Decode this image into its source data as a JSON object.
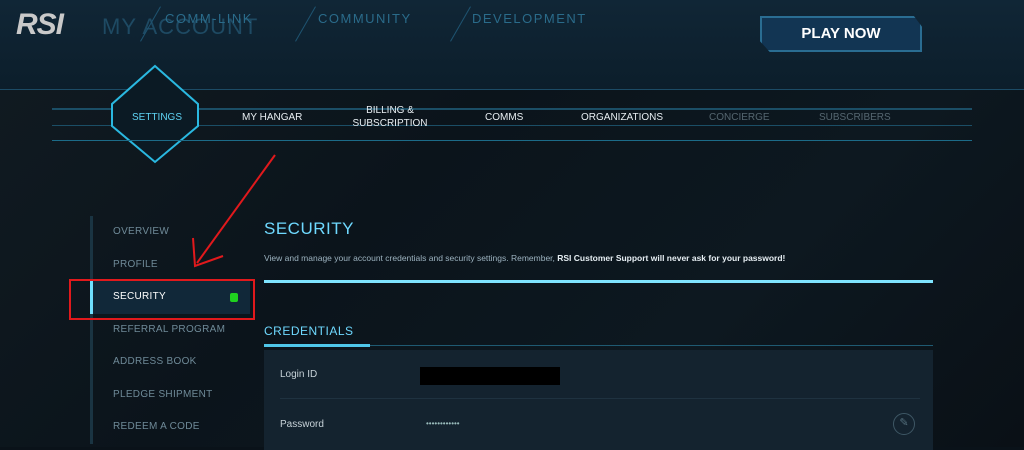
{
  "header": {
    "logo": "RSI",
    "page_title": "MY ACCOUNT",
    "nav": [
      "COMM-LINK",
      "COMMUNITY",
      "DEVELOPMENT"
    ],
    "play_now": "PLAY NOW"
  },
  "tabs": [
    {
      "label": "SETTINGS",
      "active": true
    },
    {
      "label": "MY HANGAR"
    },
    {
      "label": "BILLING & SUBSCRIPTION"
    },
    {
      "label": "COMMS"
    },
    {
      "label": "ORGANIZATIONS"
    },
    {
      "label": "CONCIERGE",
      "disabled": true
    },
    {
      "label": "SUBSCRIBERS",
      "disabled": true
    }
  ],
  "sidebar": {
    "items": [
      {
        "label": "OVERVIEW"
      },
      {
        "label": "PROFILE"
      },
      {
        "label": "SECURITY",
        "active": true
      },
      {
        "label": "REFERRAL PROGRAM"
      },
      {
        "label": "ADDRESS BOOK"
      },
      {
        "label": "PLEDGE SHIPMENT"
      },
      {
        "label": "REDEEM A CODE"
      }
    ]
  },
  "main": {
    "title": "SECURITY",
    "description": "View and manage your account credentials and security settings. Remember, ",
    "description_bold": "RSI Customer Support will never ask for your password!",
    "section": "CREDENTIALS",
    "login_label": "Login ID",
    "password_label": "Password",
    "password_value": "••••••••••••"
  },
  "colors": {
    "accent": "#6fd9ff",
    "highlight": "#e1191c",
    "lock": "#1fd11f"
  }
}
